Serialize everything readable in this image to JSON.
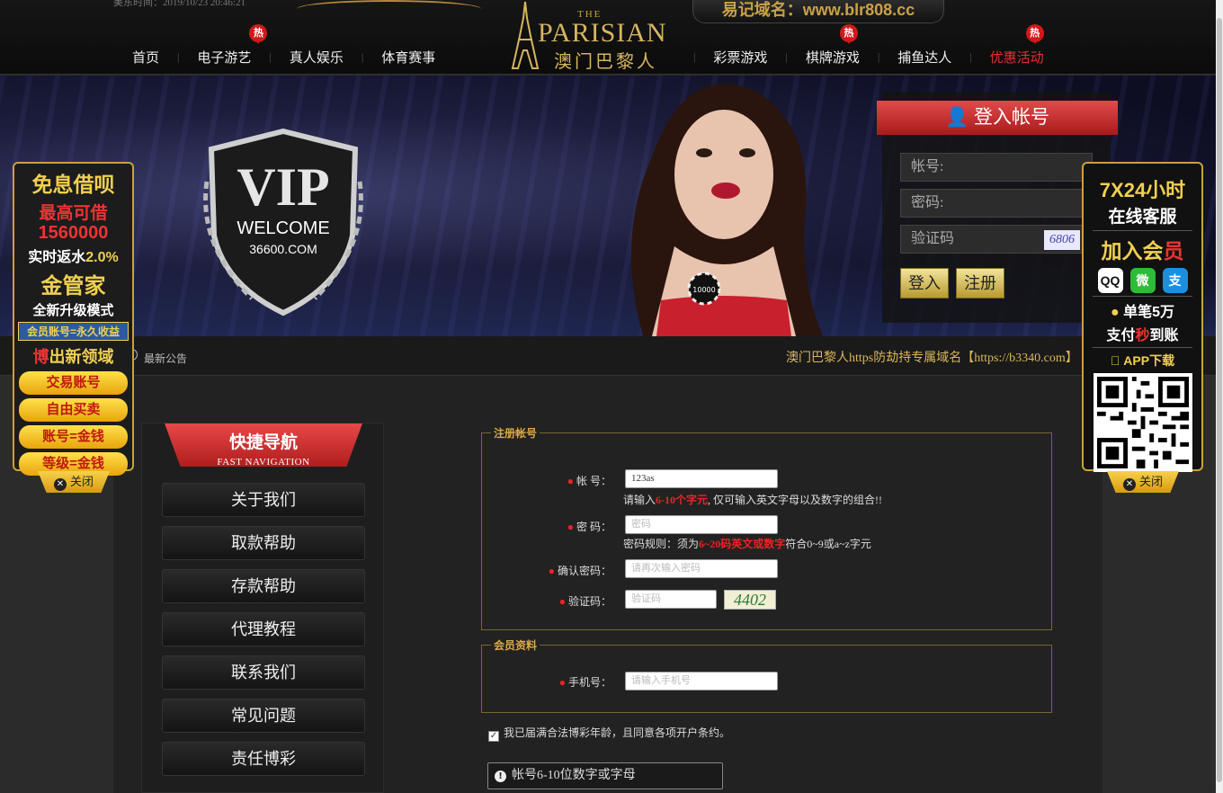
{
  "topbar": {
    "time_text": "美东时间：2019/10/23 20:46:21",
    "domain_text": "易记域名：www.blr808.cc"
  },
  "nav": {
    "left": [
      "首页",
      "电子游艺",
      "真人娱乐",
      "体育赛事"
    ],
    "right": [
      "彩票游戏",
      "棋牌游戏",
      "捕鱼达人",
      "优惠活动"
    ],
    "hot_label": "热"
  },
  "logo": {
    "the": "THE",
    "name": "PARISIAN",
    "cn": "澳门巴黎人"
  },
  "banner": {
    "vip_text": "VIP",
    "welcome": "WELCOME",
    "site": "36600.COM",
    "chip": "10000"
  },
  "login": {
    "title": "登入帐号",
    "account_placeholder": "帐号:",
    "password_placeholder": "密码:",
    "captcha_placeholder": "验证码",
    "captcha_value": "6806",
    "login_button": "登入",
    "register_button": "注册"
  },
  "notice": {
    "label": "最新公告",
    "marquee": "澳门巴黎人https防劫持专属域名【https://b3340.com】"
  },
  "sidebar": {
    "title": "快捷导航",
    "subtitle": "FAST NAVIGATION",
    "items": [
      "关于我们",
      "取款帮助",
      "存款帮助",
      "代理教程",
      "联系我们",
      "常见问题",
      "责任博彩"
    ]
  },
  "register": {
    "legend": "注册帐号",
    "account_label": "帐 号：",
    "account_value": "123as",
    "account_hint_pre": "请输入",
    "account_hint_red": "6-10个字元",
    "account_hint_post": ", 仅可输入英文字母以及数字的组合!!",
    "password_label": "密 码：",
    "password_placeholder": "密码",
    "password_hint_pre": "密码规则：须为",
    "password_hint_red": "6~20码英文或数字",
    "password_hint_post": "符合0~9或a~z字元",
    "confirm_label": "确认密码：",
    "confirm_placeholder": "请再次输入密码",
    "captcha_label": "验证码：",
    "captcha_placeholder": "验证码",
    "captcha_value": "4402"
  },
  "member": {
    "legend": "会员资料",
    "phone_label": "手机号：",
    "phone_placeholder": "请输入手机号"
  },
  "agree_text": "我已届满合法博彩年龄，且同意各项开户条约。",
  "tip_text": "帐号6-10位数字或字母",
  "float_left": {
    "l1": "免息借呗",
    "l2": "最高可借",
    "l3": "1560000",
    "l4a": "实时返水",
    "l4b": "2.0%",
    "l5": "金管家",
    "l6": "全新升级模式",
    "l7": "会员账号=永久收益",
    "l8a": "博",
    "l8b": "出新领域",
    "buttons": [
      "交易账号",
      "自由买卖",
      "账号=金钱",
      "等级=金钱"
    ],
    "close": "关闭"
  },
  "float_right": {
    "r1": "7X24小时",
    "r2": "在线客服",
    "r3a": "加入会",
    "r3b": "员",
    "apps": [
      "QQ",
      "微",
      "支"
    ],
    "r4a": "单笔5万",
    "r4b1": "支付",
    "r4b2": "秒",
    "r4b3": "到账",
    "r5": "APP下载",
    "close": "关闭"
  },
  "colors": {
    "accent_red": "#d21818",
    "gold": "#c9a23a",
    "promo_red": "#e53030"
  }
}
